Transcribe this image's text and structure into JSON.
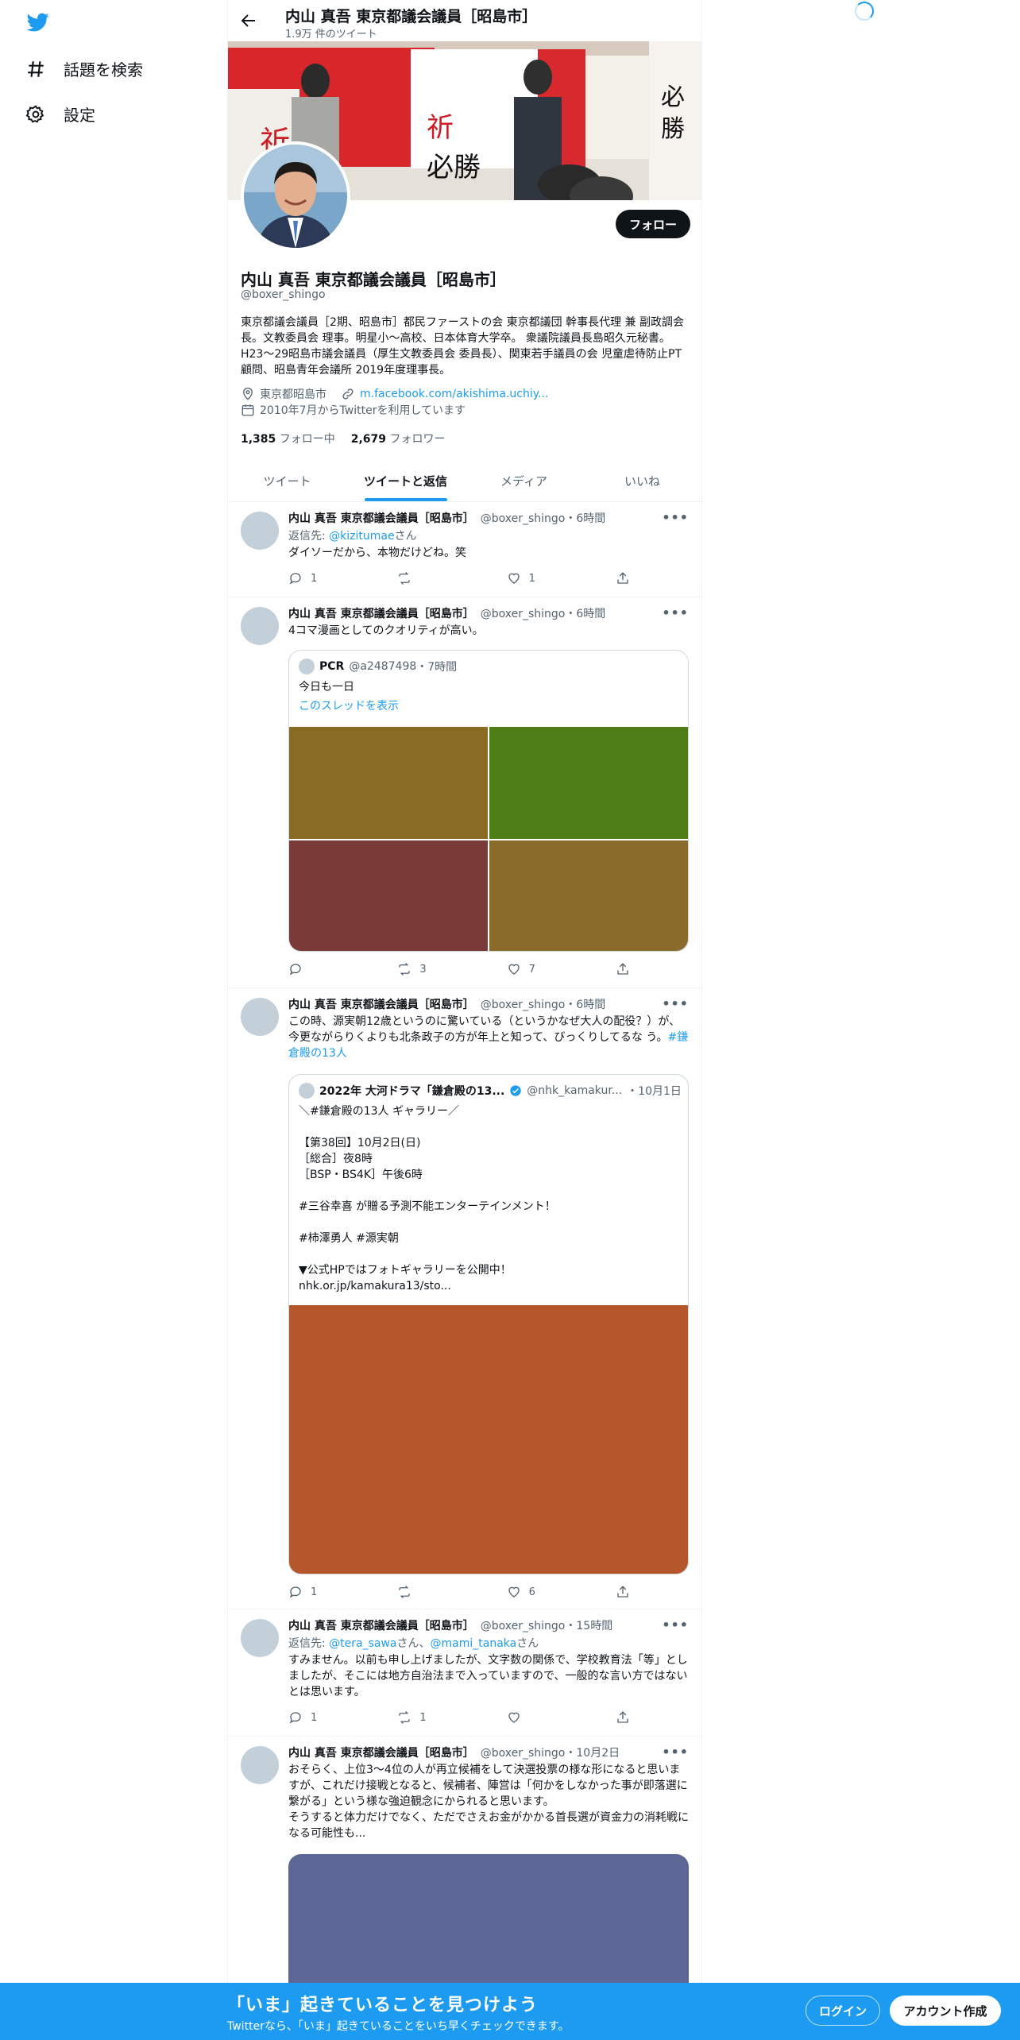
{
  "nav": {
    "logo": "twitter-bird-icon",
    "items": [
      {
        "label": "話題を検索",
        "icon": "hashtag-icon"
      },
      {
        "label": "設定",
        "icon": "gear-icon"
      }
    ]
  },
  "header": {
    "title": "内山 真吾 東京都議会議員［昭島市］",
    "subtitle": "1.9万 件のツイート"
  },
  "profile": {
    "name": "内山 真吾 東京都議会議員［昭島市］",
    "handle": "@boxer_shingo",
    "bio": "東京都議会議員［2期、昭島市］都民ファーストの会 東京都議団 幹事長代理 兼 副政調会長。文教委員会 理事。明星小〜高校、日本体育大学卒。 衆議院議員長島昭久元秘書。H23〜29昭島市議会議員（厚生文教委員会 委員長）、関東若手議員の会 児童虐待防止PT 顧問、昭島青年会議所 2019年度理事長。",
    "location": "東京都昭島市",
    "link": "m.facebook.com/akishima.uchiy...",
    "joined": "2010年7月からTwitterを利用しています",
    "following_count": "1,385",
    "following_label": "フォロー中",
    "followers_count": "2,679",
    "followers_label": "フォロワー",
    "follow_button": "フォロー"
  },
  "tabs": [
    {
      "label": "ツイート"
    },
    {
      "label": "ツイートと返信"
    },
    {
      "label": "メディア"
    },
    {
      "label": "いいね"
    }
  ],
  "tweets": [
    {
      "name": "内山 真吾 東京都議会議員［昭島市］",
      "handle": "@boxer_shingo",
      "time": "・6時間",
      "reply_prefix": "返信先: ",
      "reply_to": "@kizitumae",
      "reply_suffix": "さん",
      "text": "ダイソーだから、本物だけどね。笑",
      "replies": "1",
      "retweets": "",
      "likes": "1"
    },
    {
      "name": "内山 真吾 東京都議会議員［昭島市］",
      "handle": "@boxer_shingo",
      "time": "・6時間",
      "text": "4コマ漫画としてのクオリティが高い。",
      "quote": {
        "name": "PCR",
        "handle": "@a2487498",
        "time": "・7時間",
        "text": "今日も一日",
        "link": "このスレッドを表示",
        "image_colors": [
          "#8a6b24",
          "#4e7d16",
          "#7a3a38",
          "#8a6b2a"
        ]
      },
      "replies": "",
      "retweets": "3",
      "likes": "7"
    },
    {
      "name": "内山 真吾 東京都議会議員［昭島市］",
      "handle": "@boxer_shingo",
      "time": "・6時間",
      "text": "この時、源実朝12歳というのに驚いている（というかなぜ大人の配役？）が、今更ながらりくよりも北条政子の方が年上と知って、びっくりしてるな う。",
      "hashtag": "#鎌倉殿の13人",
      "quote": {
        "name": "2022年 大河ドラマ「鎌倉殿の13...",
        "handle": "@nhk_kamakur...",
        "time": "・10月1日",
        "text": "＼#鎌倉殿の13人 ギャラリー／\n\n【第38回】10月2日(日)\n［総合］夜8時\n［BSP・BS4K］午後6時\n\n#三谷幸喜 が贈る予測不能エンターテインメント！\n\n#柿澤勇人 #源実朝\n\n▼公式HPではフォトギャラリーを公開中！\nnhk.or.jp/kamakura13/sto...",
        "image_color": "#b5572b"
      },
      "replies": "1",
      "retweets": "",
      "likes": "6"
    },
    {
      "name": "内山 真吾 東京都議会議員［昭島市］",
      "handle": "@boxer_shingo",
      "time": "・15時間",
      "reply_prefix": "返信先: ",
      "reply_to": "@tera_sawa",
      "reply_mid": "さん、",
      "reply_to2": "@mami_tanaka",
      "reply_suffix": "さん",
      "text": "すみません。以前も申し上げましたが、文字数の関係で、学校教育法「等」としましたが、そこには地方自治法まで入っていますので、一般的な言い方ではないとは思います。",
      "replies": "1",
      "retweets": "1",
      "likes": ""
    },
    {
      "name": "内山 真吾 東京都議会議員［昭島市］",
      "handle": "@boxer_shingo",
      "time": "・10月2日",
      "text": "おそらく、上位3〜4位の人が再立候補をして決選投票の様な形になると思いますが、これだけ接戦となると、候補者、陣営は「何かをしなかった事が即落選に繋がる」という様な強迫観念にかられると思います。\nそうすると体力だけでなく、ただでさえお金がかかる首長選が資金力の消耗戦になる可能性も...",
      "image_color": "#5d6796"
    }
  ],
  "bottom": {
    "title": "「いま」起きていることを見つけよう",
    "subtitle": "Twitterなら、「いま」起きていることをいち早くチェックできます。",
    "login": "ログイン",
    "signup": "アカウント作成"
  }
}
